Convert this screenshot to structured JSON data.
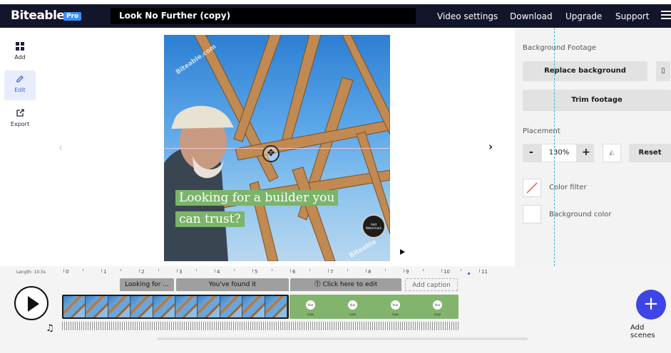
{
  "app": {
    "logo": "Biteable",
    "badge": "Pro",
    "project_title": "Look No Further (copy)"
  },
  "nav": {
    "video_settings": "Video settings",
    "download": "Download",
    "upgrade": "Upgrade",
    "support": "Support"
  },
  "toolbar": {
    "add": "Add",
    "edit": "Edit",
    "export": "Export"
  },
  "canvas": {
    "caption_line1": "Looking for a builder you",
    "caption_line2": "can trust?",
    "watermark_text": "Biteable.com",
    "watermark_bottom": "Biteable",
    "add_watermark": "Add Watermark"
  },
  "panel": {
    "section_background": "Background Footage",
    "replace_background": "Replace background",
    "trim_footage": "Trim footage",
    "section_placement": "Placement",
    "zoom_value": "130%",
    "minus": "-",
    "plus": "+",
    "reset": "Reset",
    "color_filter": "Color filter",
    "background_color": "Background color"
  },
  "timeline": {
    "length": "Length: 10.5s",
    "ruler": [
      "0",
      "1",
      "2",
      "3",
      "4",
      "5",
      "6",
      "7",
      "8",
      "9",
      "10",
      "11"
    ],
    "clips": {
      "tab1": "Looking for ...",
      "tab2": "You've found it",
      "tab3": "Click here to edit",
      "add_caption": "Add caption"
    },
    "logo_placeholder": "Your Logo",
    "add_scenes": "Add scenes",
    "add_symbol": "+"
  },
  "colors": {
    "topbar": "#13162b",
    "accent": "#3e45e6",
    "caption_bg": "#7bb46a",
    "green_clip": "#83b46d",
    "guide": "#39b7c4"
  }
}
